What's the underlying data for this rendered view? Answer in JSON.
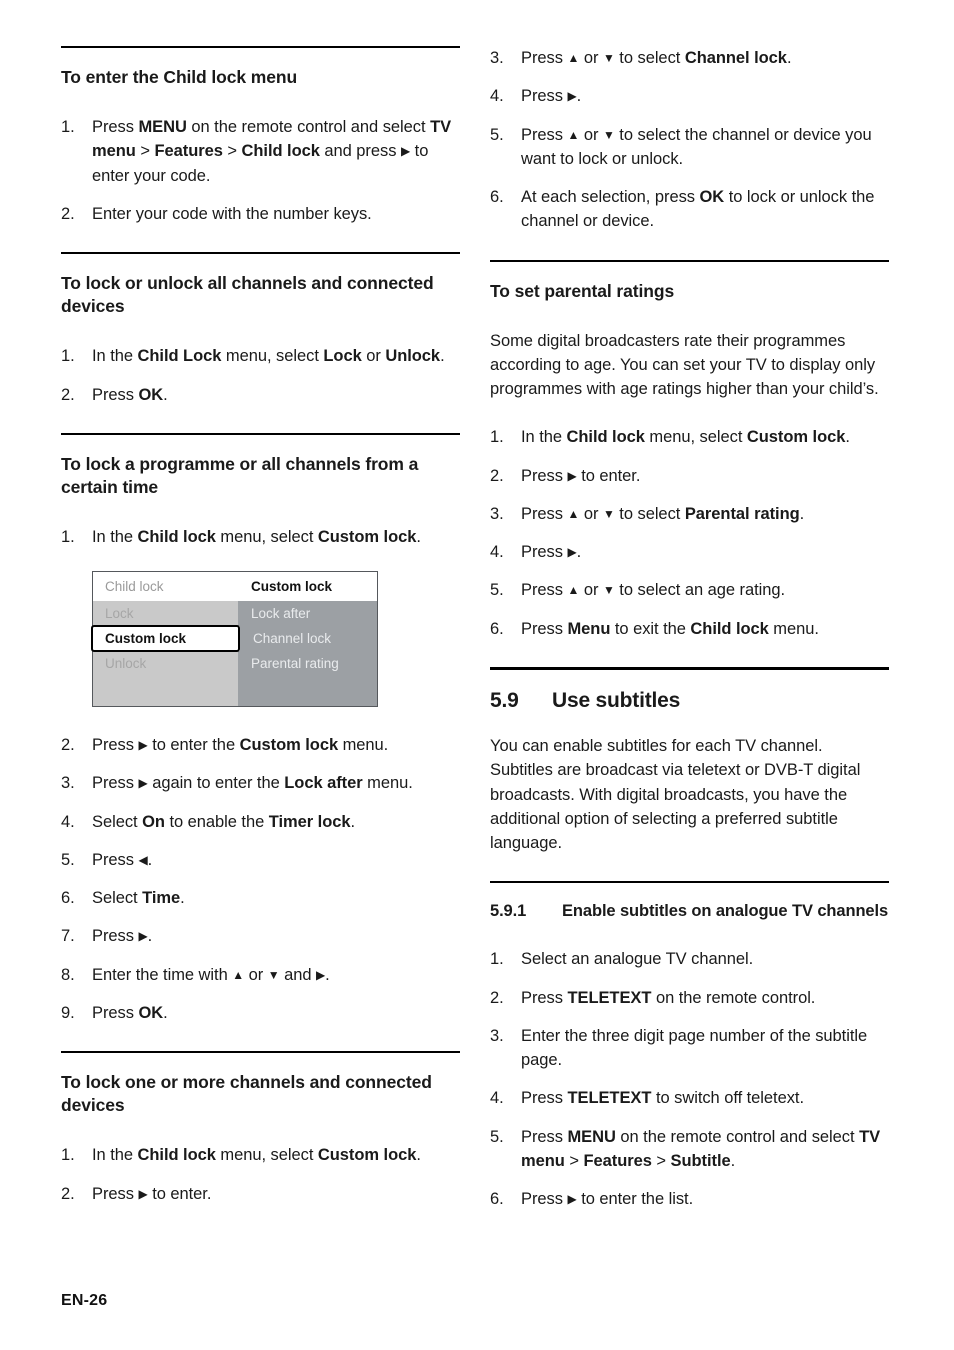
{
  "page": {
    "footer_label": "EN-26"
  },
  "left_column": {
    "section_child_lock_menu": {
      "heading": "To enter the Child lock menu",
      "steps": [
        {
          "number": "1.",
          "parts": [
            {
              "t": "Press ",
              "b": false
            },
            {
              "t": "MENU",
              "b": true
            },
            {
              "t": " on the remote control and select ",
              "b": false
            },
            {
              "t": "TV menu",
              "b": true
            },
            {
              "t": " > ",
              "b": false
            },
            {
              "t": "Features",
              "b": true
            },
            {
              "t": " > ",
              "b": false
            },
            {
              "t": "Child lock",
              "b": true
            },
            {
              "t": " and press ",
              "b": false
            },
            {
              "t": "▶",
              "b": false,
              "arrow": true
            },
            {
              "t": " to enter your code.",
              "b": false
            }
          ]
        },
        {
          "number": "2.",
          "parts": [
            {
              "t": "Enter your code with the number keys.",
              "b": false
            }
          ]
        }
      ]
    },
    "section_lock_all": {
      "heading": "To lock or unlock all channels and connected devices",
      "steps": [
        {
          "number": "1.",
          "parts": [
            {
              "t": "In the ",
              "b": false
            },
            {
              "t": "Child Lock",
              "b": true
            },
            {
              "t": " menu, select ",
              "b": false
            },
            {
              "t": "Lock",
              "b": true
            },
            {
              "t": " or ",
              "b": false
            },
            {
              "t": "Unlock",
              "b": true
            },
            {
              "t": ".",
              "b": false
            }
          ]
        },
        {
          "number": "2.",
          "parts": [
            {
              "t": "Press ",
              "b": false
            },
            {
              "t": "OK",
              "b": true
            },
            {
              "t": ".",
              "b": false
            }
          ]
        }
      ]
    },
    "section_lock_programme": {
      "heading": "To lock a programme or all channels from a certain time",
      "steps_before_image": [
        {
          "number": "1.",
          "parts": [
            {
              "t": "In the ",
              "b": false
            },
            {
              "t": "Child lock",
              "b": true
            },
            {
              "t": " menu, select ",
              "b": false
            },
            {
              "t": "Custom lock",
              "b": true
            },
            {
              "t": ".",
              "b": false
            }
          ]
        }
      ],
      "tv_menu_image": {
        "title_left": "Child lock",
        "title_right": "Custom lock",
        "rows": [
          {
            "left": "Lock",
            "right": "Lock after",
            "selected": false
          },
          {
            "left": "Custom lock",
            "right": "Channel lock",
            "selected": true
          },
          {
            "left": "Unlock",
            "right": "Parental rating",
            "selected": false
          }
        ]
      },
      "steps_after_image": [
        {
          "number": "2.",
          "parts": [
            {
              "t": "Press ",
              "b": false
            },
            {
              "t": "▶",
              "b": false,
              "arrow": true
            },
            {
              "t": " to enter the ",
              "b": false
            },
            {
              "t": "Custom lock",
              "b": true
            },
            {
              "t": " menu.",
              "b": false
            }
          ]
        },
        {
          "number": "3.",
          "parts": [
            {
              "t": "Press ",
              "b": false
            },
            {
              "t": "▶",
              "b": false,
              "arrow": true
            },
            {
              "t": " again to enter the ",
              "b": false
            },
            {
              "t": "Lock after",
              "b": true
            },
            {
              "t": " menu.",
              "b": false
            }
          ]
        },
        {
          "number": "4.",
          "parts": [
            {
              "t": "Select ",
              "b": false
            },
            {
              "t": "On",
              "b": true
            },
            {
              "t": " to enable the ",
              "b": false
            },
            {
              "t": "Timer lock",
              "b": true
            },
            {
              "t": ".",
              "b": false
            }
          ]
        },
        {
          "number": "5.",
          "parts": [
            {
              "t": "Press ",
              "b": false
            },
            {
              "t": "◀",
              "b": false,
              "arrow": true
            },
            {
              "t": ".",
              "b": false
            }
          ]
        },
        {
          "number": "6.",
          "parts": [
            {
              "t": "Select ",
              "b": false
            },
            {
              "t": "Time",
              "b": true
            },
            {
              "t": ".",
              "b": false
            }
          ]
        },
        {
          "number": "7.",
          "parts": [
            {
              "t": "Press ",
              "b": false
            },
            {
              "t": "▶",
              "b": false,
              "arrow": true
            },
            {
              "t": ".",
              "b": false
            }
          ]
        },
        {
          "number": "8.",
          "parts": [
            {
              "t": "Enter the time with ",
              "b": false
            },
            {
              "t": "▲",
              "b": false,
              "arrow": true
            },
            {
              "t": " or ",
              "b": false
            },
            {
              "t": "▼",
              "b": false,
              "arrow": true
            },
            {
              "t": " and ",
              "b": false
            },
            {
              "t": "▶",
              "b": false,
              "arrow": true
            },
            {
              "t": ".",
              "b": false
            }
          ]
        },
        {
          "number": "9.",
          "parts": [
            {
              "t": "Press ",
              "b": false
            },
            {
              "t": "OK",
              "b": true
            },
            {
              "t": ".",
              "b": false
            }
          ]
        }
      ]
    },
    "section_lock_one_or_more": {
      "heading": "To lock one or more channels and connected devices",
      "steps": [
        {
          "number": "1.",
          "parts": [
            {
              "t": "In the ",
              "b": false
            },
            {
              "t": "Child lock",
              "b": true
            },
            {
              "t": " menu, select ",
              "b": false
            },
            {
              "t": "Custom lock",
              "b": true
            },
            {
              "t": ".",
              "b": false
            }
          ]
        },
        {
          "number": "2.",
          "parts": [
            {
              "t": "Press ",
              "b": false
            },
            {
              "t": "▶",
              "b": false,
              "arrow": true
            },
            {
              "t": " to enter.",
              "b": false
            }
          ]
        }
      ]
    }
  },
  "right_column": {
    "continued_steps": [
      {
        "number": "3.",
        "parts": [
          {
            "t": "Press ",
            "b": false
          },
          {
            "t": "▲",
            "b": false,
            "arrow": true
          },
          {
            "t": " or ",
            "b": false
          },
          {
            "t": "▼",
            "b": false,
            "arrow": true
          },
          {
            "t": " to select ",
            "b": false
          },
          {
            "t": "Channel lock",
            "b": true
          },
          {
            "t": ".",
            "b": false
          }
        ]
      },
      {
        "number": "4.",
        "parts": [
          {
            "t": "Press ",
            "b": false
          },
          {
            "t": "▶",
            "b": false,
            "arrow": true
          },
          {
            "t": ".",
            "b": false
          }
        ]
      },
      {
        "number": "5.",
        "parts": [
          {
            "t": "Press ",
            "b": false
          },
          {
            "t": "▲",
            "b": false,
            "arrow": true
          },
          {
            "t": " or ",
            "b": false
          },
          {
            "t": "▼",
            "b": false,
            "arrow": true
          },
          {
            "t": " to select the channel or device you want to lock or unlock.",
            "b": false
          }
        ]
      },
      {
        "number": "6.",
        "parts": [
          {
            "t": "At each selection, press ",
            "b": false
          },
          {
            "t": "OK",
            "b": true
          },
          {
            "t": " to lock or unlock the channel or device.",
            "b": false
          }
        ]
      }
    ],
    "section_parental_ratings": {
      "heading": "To set parental ratings",
      "intro": "Some digital broadcasters rate their programmes according to age. You can set your TV to display only programmes with age ratings higher than your child’s.",
      "steps": [
        {
          "number": "1.",
          "parts": [
            {
              "t": "In the ",
              "b": false
            },
            {
              "t": "Child lock",
              "b": true
            },
            {
              "t": " menu, select ",
              "b": false
            },
            {
              "t": "Custom lock",
              "b": true
            },
            {
              "t": ".",
              "b": false
            }
          ]
        },
        {
          "number": "2.",
          "parts": [
            {
              "t": "Press ",
              "b": false
            },
            {
              "t": "▶",
              "b": false,
              "arrow": true
            },
            {
              "t": " to enter.",
              "b": false
            }
          ]
        },
        {
          "number": "3.",
          "parts": [
            {
              "t": "Press ",
              "b": false
            },
            {
              "t": "▲",
              "b": false,
              "arrow": true
            },
            {
              "t": " or ",
              "b": false
            },
            {
              "t": "▼",
              "b": false,
              "arrow": true
            },
            {
              "t": " to select ",
              "b": false
            },
            {
              "t": "Parental rating",
              "b": true
            },
            {
              "t": ".",
              "b": false
            }
          ]
        },
        {
          "number": "4.",
          "parts": [
            {
              "t": "Press ",
              "b": false
            },
            {
              "t": "▶",
              "b": false,
              "arrow": true
            },
            {
              "t": ".",
              "b": false
            }
          ]
        },
        {
          "number": "5.",
          "parts": [
            {
              "t": "Press ",
              "b": false
            },
            {
              "t": "▲",
              "b": false,
              "arrow": true
            },
            {
              "t": " or ",
              "b": false
            },
            {
              "t": "▼",
              "b": false,
              "arrow": true
            },
            {
              "t": " to select an age rating.",
              "b": false
            }
          ]
        },
        {
          "number": "6.",
          "parts": [
            {
              "t": "Press ",
              "b": false
            },
            {
              "t": "Menu",
              "b": true
            },
            {
              "t": " to exit the ",
              "b": false
            },
            {
              "t": "Child lock",
              "b": true
            },
            {
              "t": " menu.",
              "b": false
            }
          ]
        }
      ]
    },
    "section_use_subtitles": {
      "number": "5.9",
      "title": "Use subtitles",
      "intro": "You can enable subtitles for each TV channel. Subtitles are broadcast via teletext or DVB-T digital broadcasts. With digital broadcasts, you have the additional option of selecting a preferred subtitle language."
    },
    "section_enable_analogue": {
      "number": "5.9.1",
      "title": "Enable subtitles on analogue TV channels",
      "steps": [
        {
          "number": "1.",
          "parts": [
            {
              "t": "Select an analogue TV channel.",
              "b": false
            }
          ]
        },
        {
          "number": "2.",
          "parts": [
            {
              "t": "Press ",
              "b": false
            },
            {
              "t": "TELETEXT",
              "b": true
            },
            {
              "t": " on the remote control.",
              "b": false
            }
          ]
        },
        {
          "number": "3.",
          "parts": [
            {
              "t": "Enter the three digit page number of the subtitle page.",
              "b": false
            }
          ]
        },
        {
          "number": "4.",
          "parts": [
            {
              "t": "Press ",
              "b": false
            },
            {
              "t": "TELETEXT",
              "b": true
            },
            {
              "t": " to switch off teletext.",
              "b": false
            }
          ]
        },
        {
          "number": "5.",
          "parts": [
            {
              "t": "Press ",
              "b": false
            },
            {
              "t": "MENU",
              "b": true
            },
            {
              "t": " on the remote control and select ",
              "b": false
            },
            {
              "t": "TV menu",
              "b": true
            },
            {
              "t": " > ",
              "b": false
            },
            {
              "t": "Features",
              "b": true
            },
            {
              "t": " > ",
              "b": false
            },
            {
              "t": "Subtitle",
              "b": true
            },
            {
              "t": ".",
              "b": false
            }
          ]
        },
        {
          "number": "6.",
          "parts": [
            {
              "t": "Press ",
              "b": false
            },
            {
              "t": "▶",
              "b": false,
              "arrow": true
            },
            {
              "t": " to enter the list.",
              "b": false
            }
          ]
        }
      ]
    }
  }
}
